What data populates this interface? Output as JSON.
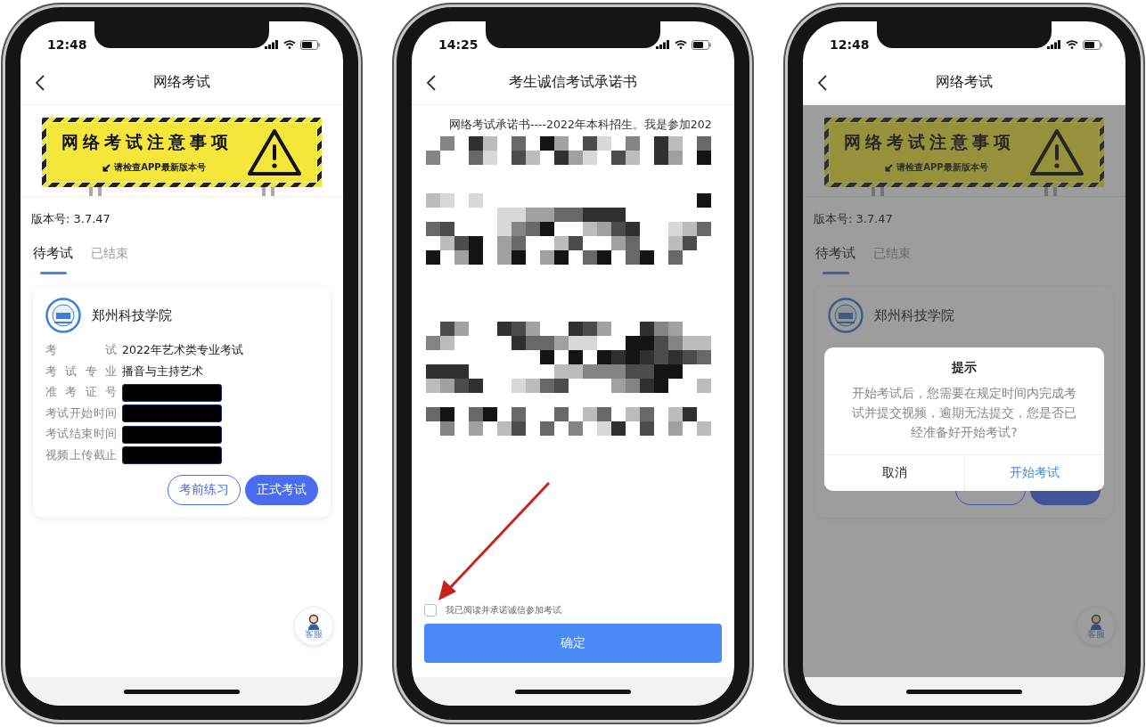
{
  "phones": [
    {
      "kind": "exam_list",
      "time": "12:48",
      "title": "网络考试",
      "banner": {
        "heading": "网络考试注意事项",
        "subtext": "请检查APP最新版本号"
      },
      "version": "版本号: 3.7.47",
      "tabs": [
        {
          "label": "待考试",
          "selected": true
        },
        {
          "label": "已结束",
          "selected": false
        }
      ],
      "card": {
        "school": "郑州科技学院",
        "rows": [
          {
            "label": "考试",
            "value": "2022年艺术类专业考试",
            "redacted": false
          },
          {
            "label": "考试专业",
            "value": "播音与主持艺术",
            "redacted": false
          },
          {
            "label": "准考证号",
            "redacted": true
          },
          {
            "label": "考试开始时间",
            "redacted": true
          },
          {
            "label": "考试结束时间",
            "redacted": true
          },
          {
            "label": "视频上传截止",
            "redacted": true
          }
        ],
        "buttons": [
          {
            "label": "考前练习",
            "kind": "outline"
          },
          {
            "label": "正式考试",
            "kind": "primary"
          }
        ]
      },
      "support": "客服"
    },
    {
      "kind": "pledge",
      "time": "14:25",
      "title": "考生诚信考试承诺书",
      "text": "网络考试承诺书----2022年本科招生。我是参加202",
      "agreement": {
        "label": "我已阅读并承诺诚信参加考试",
        "checked": false
      },
      "confirm": "确定"
    },
    {
      "kind": "exam_list",
      "time": "12:48",
      "title": "网络考试",
      "banner": {
        "heading": "网络考试注意事项",
        "subtext": "请检查APP最新版本号"
      },
      "version": "版本号: 3.7.47",
      "tabs": [
        {
          "label": "待考试",
          "selected": true
        },
        {
          "label": "已结束",
          "selected": false
        }
      ],
      "card": {
        "school": "郑州科技学院",
        "buttons": [
          {
            "kind": "outline"
          },
          {
            "kind": "primary"
          }
        ]
      },
      "support": "客服",
      "dialog": {
        "title": "提示",
        "message": "开始考试后，您需要在规定时间内完成考试并提交视频，逾期无法提交，您是否已经准备好开始考试?",
        "buttons": [
          {
            "label": "取消",
            "kind": "cancel"
          },
          {
            "label": "开始考试",
            "kind": "confirm"
          }
        ]
      }
    }
  ]
}
